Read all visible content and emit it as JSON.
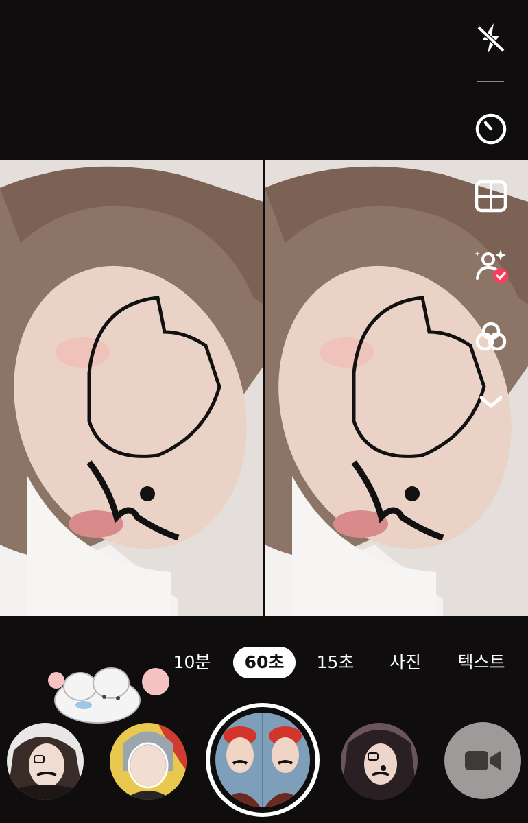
{
  "toolbar": {
    "items": [
      {
        "icon": "flash-off-icon"
      },
      {
        "icon": "timer-icon"
      },
      {
        "icon": "layout-grid-icon"
      },
      {
        "icon": "people-sparkle-icon",
        "checked": true
      },
      {
        "icon": "filters-icon"
      },
      {
        "icon": "chevron-down-icon"
      }
    ],
    "badge_color": "#ff3b5c"
  },
  "modes": {
    "items": [
      {
        "label": "10분"
      },
      {
        "label": "60초",
        "active": true
      },
      {
        "label": "15초"
      },
      {
        "label": "사진"
      },
      {
        "label": "텍스트"
      }
    ]
  },
  "effects": {
    "items": [
      {
        "icon": "effect-doodle-cat-icon"
      },
      {
        "icon": "effect-shark-hood-icon"
      },
      {
        "icon": "effect-red-cap-duo-icon",
        "selected": true
      },
      {
        "icon": "effect-doodle-mustache-icon"
      }
    ]
  },
  "record": {
    "icon": "video-camera-icon"
  },
  "colors": {
    "background": "#0f0d0d",
    "active_tab": "#ffffff",
    "record_button": "#9e9a9a"
  }
}
